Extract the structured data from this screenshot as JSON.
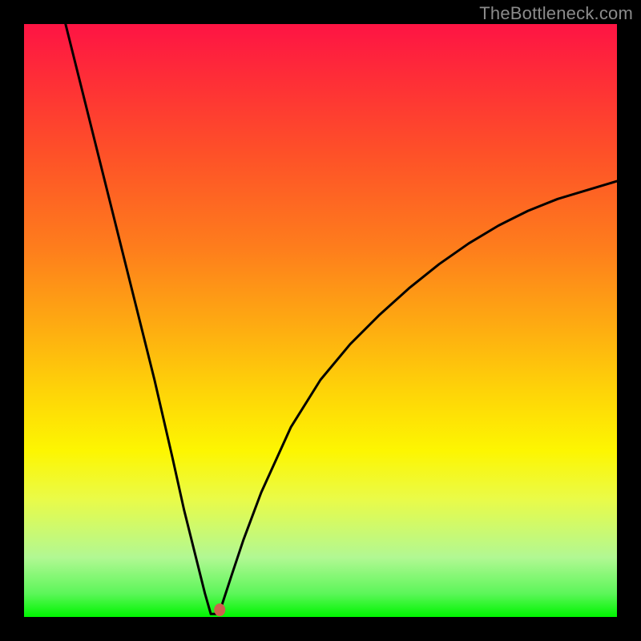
{
  "watermark": "TheBottleneck.com",
  "chart_data": {
    "type": "line",
    "title": "",
    "xlabel": "",
    "ylabel": "",
    "xlim": [
      0,
      100
    ],
    "ylim": [
      0,
      100
    ],
    "grid": false,
    "series": [
      {
        "name": "curve",
        "x": [
          7,
          10,
          14,
          18,
          22,
          25,
          27,
          29,
          30.5,
          31.5,
          32.5,
          33.2,
          35,
          37,
          40,
          45,
          50,
          55,
          60,
          65,
          70,
          75,
          80,
          85,
          90,
          95,
          100
        ],
        "y": [
          100,
          88,
          72,
          56,
          40,
          27,
          18,
          10,
          4,
          0.5,
          0.5,
          1.5,
          7,
          13,
          21,
          32,
          40,
          46,
          51,
          55.5,
          59.5,
          63,
          66,
          68.5,
          70.5,
          72,
          73.5
        ]
      }
    ],
    "marker": {
      "name": "min-marker",
      "x": 33,
      "y": 1.2,
      "color": "#d0604e",
      "rx": 7,
      "ry": 8
    },
    "gradient_stops": [
      {
        "pos": 0,
        "color": "#fe1444"
      },
      {
        "pos": 10,
        "color": "#fe3036"
      },
      {
        "pos": 22,
        "color": "#fe5128"
      },
      {
        "pos": 38,
        "color": "#fe7e1c"
      },
      {
        "pos": 50,
        "color": "#fea812"
      },
      {
        "pos": 62,
        "color": "#fed408"
      },
      {
        "pos": 72,
        "color": "#fdf601"
      },
      {
        "pos": 80,
        "color": "#eafb47"
      },
      {
        "pos": 90,
        "color": "#b1f893"
      },
      {
        "pos": 96,
        "color": "#5df65a"
      },
      {
        "pos": 100,
        "color": "#00f500"
      }
    ]
  }
}
